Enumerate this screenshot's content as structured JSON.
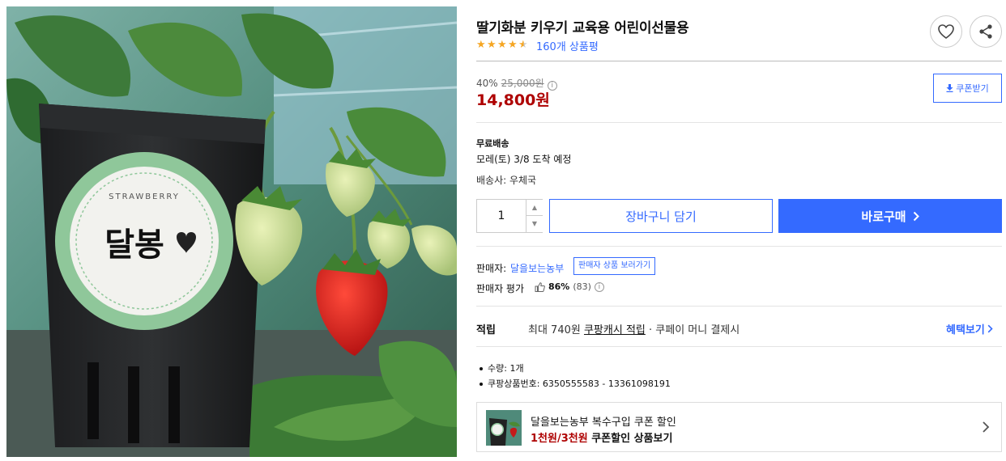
{
  "product": {
    "title": "딸기화분 키우기 교육용 어린이선물용",
    "rating_stars": 4.5,
    "review_link": "160개 상품평",
    "image_label_text": "달봉",
    "image_label_small": "STRAWBERRY"
  },
  "actions": {
    "wishlist_icon": "heart-icon",
    "share_icon": "share-icon"
  },
  "price": {
    "discount_rate": "40%",
    "original": "25,000원",
    "sale": "14,800원",
    "coupon_button": "쿠폰받기"
  },
  "shipping": {
    "title": "무료배송",
    "arrival": "모레(토) 3/8 도착 예정",
    "carrier": "배송사: 우체국"
  },
  "purchase": {
    "quantity": "1",
    "cart_button": "장바구니 담기",
    "buy_button": "바로구매"
  },
  "seller": {
    "label": "판매자:",
    "name": "달을보는농부",
    "tooltip": "판매자 상품 보러가기",
    "rating_label": "판매자 평가",
    "rating_percent": "86%",
    "rating_count": "(83)"
  },
  "reward": {
    "label": "적립",
    "text_prefix": "최대 740원",
    "text_link": "쿠팡캐시 적립",
    "text_suffix": "· 쿠페이 머니 결제시",
    "benefit_link": "혜택보기"
  },
  "details": [
    "수량: 1개",
    "쿠팡상품번호: 6350555583 - 13361098191"
  ],
  "promo": {
    "title": "달을보는농부 복수구입 쿠폰 할인",
    "sub_red": "1천원/3천원",
    "sub_black": "쿠폰할인 상품보기"
  },
  "colors": {
    "accent": "#346aff",
    "price_red": "#ae0000",
    "star": "#f5a623"
  }
}
